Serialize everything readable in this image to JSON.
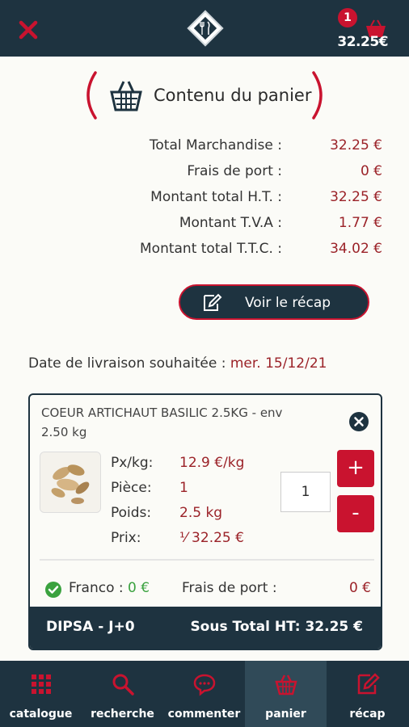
{
  "header": {
    "cart_count": "1",
    "cart_total": "32.25€"
  },
  "section": {
    "title": "Contenu du panier"
  },
  "summary": [
    {
      "label": "Total Marchandise :",
      "value": "32.25 €"
    },
    {
      "label": "Frais de port :",
      "value": "0 €"
    },
    {
      "label": "Montant total H.T. :",
      "value": "32.25 €"
    },
    {
      "label": "Montant T.V.A :",
      "value": "1.77 €"
    },
    {
      "label": "Montant total T.T.C. :",
      "value": "34.02 €"
    }
  ],
  "recap_button": {
    "label": "Voir le récap"
  },
  "delivery": {
    "label": "Date de livraison souhaitée :",
    "date": "mer. 15/12/21"
  },
  "product": {
    "name": "COEUR ARTICHAUT BASILIC 2.5KG - env 2.50 kg",
    "attrs": [
      {
        "label": "Px/kg:",
        "value": "12.9 €/kg"
      },
      {
        "label": "Pièce:",
        "value": "1"
      },
      {
        "label": "Poids:",
        "value": "2.5 kg"
      },
      {
        "label": "Prix:",
        "value": "⅟ 32.25 €"
      }
    ],
    "quantity": "1",
    "plus": "+",
    "minus": "-",
    "franco_label": "Franco :",
    "franco_value": "0 €",
    "port_label": "Frais de port :",
    "port_value": "0 €",
    "supplier": "DIPSA - J+0",
    "subtotal": "Sous Total HT: 32.25 €"
  },
  "nav": [
    {
      "label": "catalogue",
      "icon": "grid-icon"
    },
    {
      "label": "recherche",
      "icon": "search-icon"
    },
    {
      "label": "commenter",
      "icon": "chat-icon"
    },
    {
      "label": "panier",
      "icon": "basket-icon",
      "active": true
    },
    {
      "label": "récap",
      "icon": "edit-icon"
    }
  ],
  "colors": {
    "primary": "#1e3340",
    "accent": "#c9132f",
    "value": "#9b2228",
    "success": "#3aa23f"
  }
}
